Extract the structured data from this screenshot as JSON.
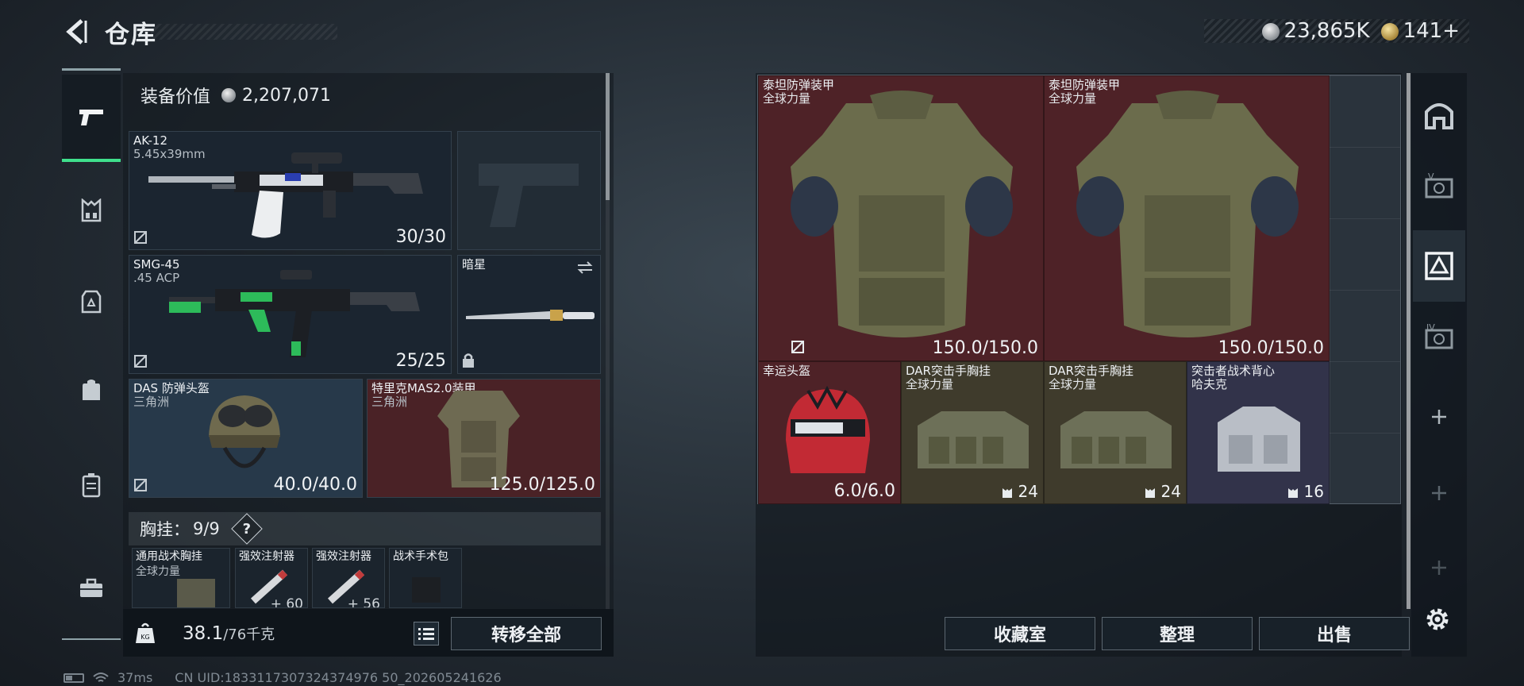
{
  "header": {
    "title": "仓库",
    "currency_1": "23,865K",
    "currency_2": "141+"
  },
  "nav": {
    "items": [
      "weapons",
      "chest-rig",
      "armor",
      "backpack",
      "case",
      "toolbox"
    ]
  },
  "loadout": {
    "equip_value_label": "装备价值",
    "equip_value": "2,207,071",
    "primary": {
      "name": "AK-12",
      "ammo_type": "5.45x39mm",
      "ammo": "30/30"
    },
    "secondary": {
      "name": "SMG-45",
      "ammo_type": ".45 ACP",
      "ammo": "25/25"
    },
    "melee": {
      "name": "暗星"
    },
    "helmet": {
      "name": "DAS 防弹头盔",
      "sub": "三角洲",
      "durability": "40.0/40.0"
    },
    "armor": {
      "name": "特里克MAS2.0装甲",
      "sub": "三角洲",
      "durability": "125.0/125.0"
    },
    "chest_rig": {
      "label": "胸挂：",
      "count": "9/9",
      "help": "?",
      "items": [
        {
          "name": "通用战术胸挂",
          "sub": "全球力量",
          "count": ""
        },
        {
          "name": "强效注射器",
          "sub": "",
          "count": "60"
        },
        {
          "name": "强效注射器",
          "sub": "",
          "count": "56"
        },
        {
          "name": "战术手术包",
          "sub": "",
          "count": ""
        }
      ]
    },
    "weight": "38.1",
    "weight_max": "/76千克",
    "transfer_all": "转移全部"
  },
  "stash": {
    "items": [
      {
        "name": "泰坦防弹装甲",
        "sub": "全球力量",
        "value": "150.0/150.0"
      },
      {
        "name": "泰坦防弹装甲",
        "sub": "全球力量",
        "value": "150.0/150.0"
      },
      {
        "name": "幸运头盔",
        "sub": "",
        "value": "6.0/6.0"
      },
      {
        "name": "DAR突击手胸挂",
        "sub": "全球力量",
        "value": "24"
      },
      {
        "name": "DAR突击手胸挂",
        "sub": "全球力量",
        "value": "24"
      },
      {
        "name": "突击者战术背心",
        "sub": "哈夫克",
        "value": "16"
      }
    ],
    "buttons": {
      "collection": "收藏室",
      "organize": "整理",
      "sell": "出售"
    }
  },
  "status": {
    "ping": "37ms",
    "uid": "CN UID:1833117307324374976 50_202605241626"
  },
  "colors": {
    "accent_green": "#3fe08c",
    "item_red": "#4e2227",
    "item_olive": "#3f3b2c",
    "item_navy": "#32334a"
  }
}
